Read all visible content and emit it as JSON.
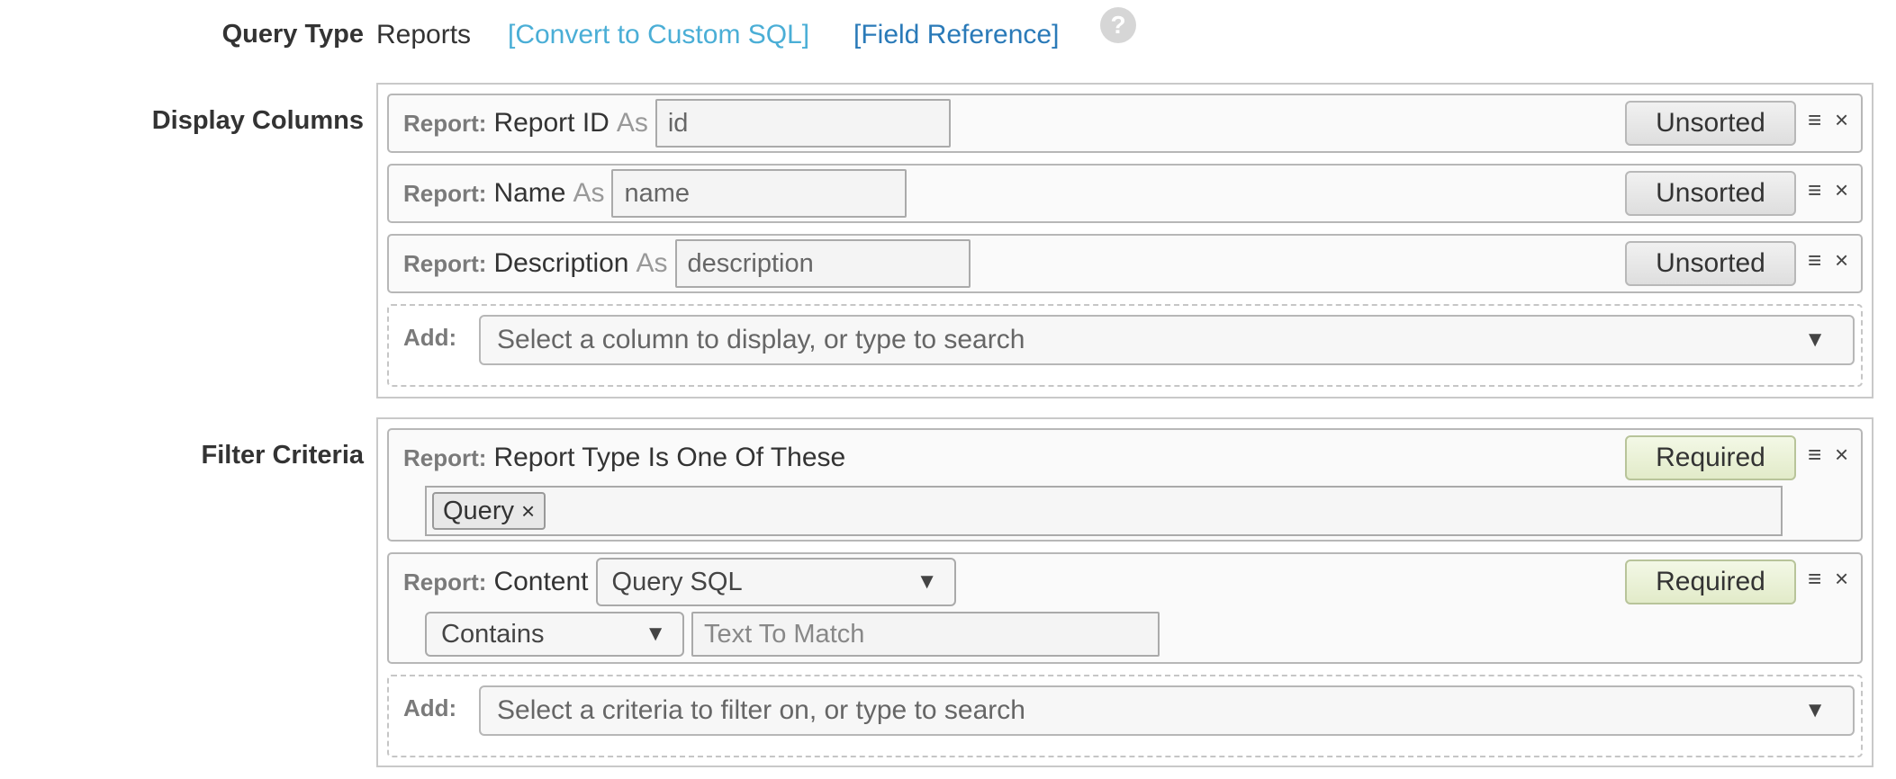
{
  "query_type": {
    "label": "Query Type",
    "value": "Reports",
    "convert_link": "[Convert to Custom SQL]",
    "field_ref_link": "[Field Reference]",
    "help": "?"
  },
  "display_columns": {
    "label": "Display Columns",
    "rows": [
      {
        "prefix": "Report:",
        "field": "Report ID",
        "as": "As",
        "alias": "id",
        "sort": "Unsorted"
      },
      {
        "prefix": "Report:",
        "field": "Name",
        "as": "As",
        "alias": "name",
        "sort": "Unsorted"
      },
      {
        "prefix": "Report:",
        "field": "Description",
        "as": "As",
        "alias": "description",
        "sort": "Unsorted"
      }
    ],
    "add_label": "Add:",
    "add_placeholder": "Select a column to display, or type to search"
  },
  "filter_criteria": {
    "label": "Filter Criteria",
    "row1": {
      "prefix": "Report:",
      "text": "Report Type Is One Of These",
      "tag": "Query",
      "tag_remove": "×",
      "button": "Required"
    },
    "row2": {
      "prefix": "Report:",
      "field": "Content",
      "field_select": "Query SQL",
      "operator": "Contains",
      "match_placeholder": "Text To Match",
      "button": "Required"
    },
    "add_label": "Add:",
    "add_placeholder": "Select a criteria to filter on, or type to search"
  },
  "icons": {
    "drag": "≡",
    "remove": "×",
    "caret": "▼"
  },
  "colors": {
    "link_light": "#4aaed6",
    "link_dark": "#2a7ab8",
    "required_bg": "#eaf1d4"
  }
}
